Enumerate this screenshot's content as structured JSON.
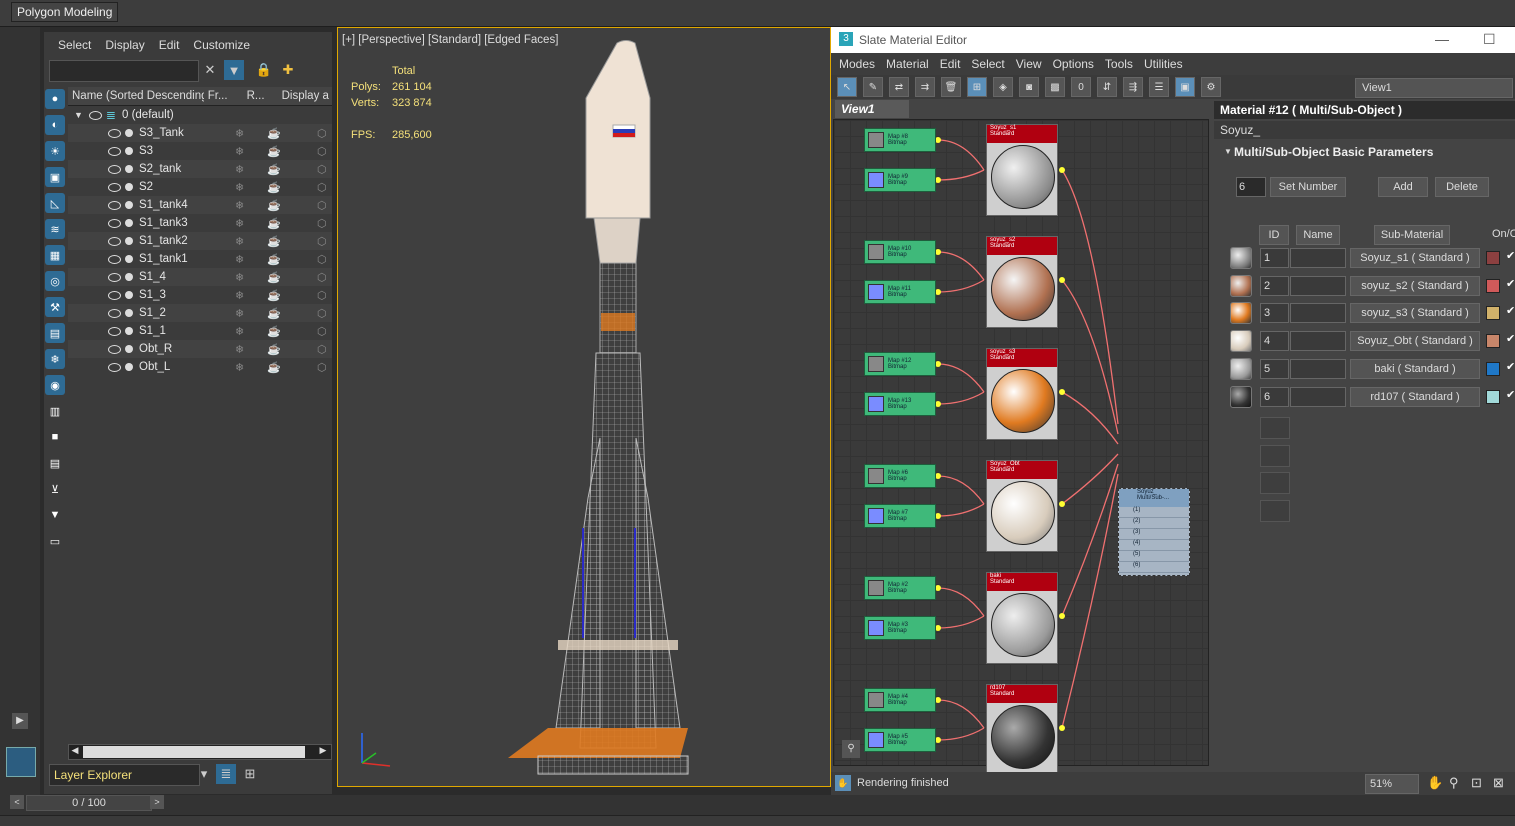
{
  "ribbon": {
    "tab": "Polygon Modeling"
  },
  "explorer": {
    "menu": [
      "Select",
      "Display",
      "Edit",
      "Customize"
    ],
    "columns": [
      "Name (Sorted Descending)",
      "Fr...",
      "R...",
      "Display a"
    ],
    "root": "0 (default)",
    "items": [
      "S3_Tank",
      "S3",
      "S2_tank",
      "S2",
      "S1_tank4",
      "S1_tank3",
      "S1_tank2",
      "S1_tank1",
      "S1_4",
      "S1_3",
      "S1_2",
      "S1_1",
      "Obt_R",
      "Obt_L"
    ],
    "layer_label": "Layer Explorer"
  },
  "viewport": {
    "label": "[+] [Perspective] [Standard] [Edged Faces]",
    "stats": {
      "total_label": "Total",
      "polys_label": "Polys:",
      "polys": "261 104",
      "verts_label": "Verts:",
      "verts": "323 874",
      "fps_label": "FPS:",
      "fps": "285,600"
    }
  },
  "slate": {
    "title": "Slate Material Editor",
    "menu": [
      "Modes",
      "Material",
      "Edit",
      "Select",
      "View",
      "Options",
      "Tools",
      "Utilities"
    ],
    "view_dropdown": "View1",
    "view_tab": "View1",
    "status": "Rendering finished",
    "zoom": "51%",
    "maps": [
      {
        "name": "Map #8",
        "type": "Bitmap"
      },
      {
        "name": "Map #9",
        "type": "Bitmap"
      },
      {
        "name": "Map #10",
        "type": "Bitmap"
      },
      {
        "name": "Map #11",
        "type": "Bitmap"
      },
      {
        "name": "Map #12",
        "type": "Bitmap"
      },
      {
        "name": "Map #13",
        "type": "Bitmap"
      },
      {
        "name": "Map #6",
        "type": "Bitmap"
      },
      {
        "name": "Map #7",
        "type": "Bitmap"
      },
      {
        "name": "Map #2",
        "type": "Bitmap"
      },
      {
        "name": "Map #3",
        "type": "Bitmap"
      },
      {
        "name": "Map #4",
        "type": "Bitmap"
      },
      {
        "name": "Map #5",
        "type": "Bitmap"
      }
    ],
    "materials": [
      {
        "name": "Soyuz_s1",
        "type": "Standard"
      },
      {
        "name": "soyuz_s2",
        "type": "Standard"
      },
      {
        "name": "soyuz_s3",
        "type": "Standard"
      },
      {
        "name": "Soyuz_Obt",
        "type": "Standard"
      },
      {
        "name": "baki",
        "type": "Standard"
      },
      {
        "name": "rd107",
        "type": "Standard"
      }
    ],
    "multi_node": {
      "name": "Soyuz_",
      "type": "Multi/Sub-...",
      "slots": [
        "(1)",
        "(2)",
        "(3)",
        "(4)",
        "(5)",
        "(6)"
      ]
    }
  },
  "props": {
    "title": "Material #12  ( Multi/Sub-Object )",
    "name_field": "Soyuz_",
    "rollout": "Multi/Sub-Object Basic Parameters",
    "count": "6",
    "set_number": "Set Number",
    "add": "Add",
    "delete": "Delete",
    "headers": {
      "id": "ID",
      "name": "Name",
      "sub": "Sub-Material",
      "onoff": "On/O"
    },
    "rows": [
      {
        "id": "1",
        "sub": "Soyuz_s1  ( Standard )",
        "color": "#8c4040"
      },
      {
        "id": "2",
        "sub": "soyuz_s2  ( Standard )",
        "color": "#d05a5a"
      },
      {
        "id": "3",
        "sub": "soyuz_s3  ( Standard )",
        "color": "#d2b26a"
      },
      {
        "id": "4",
        "sub": "Soyuz_Obt  ( Standard )",
        "color": "#c8866a"
      },
      {
        "id": "5",
        "sub": "baki  ( Standard )",
        "color": "#1f78c8"
      },
      {
        "id": "6",
        "sub": "rd107  ( Standard )",
        "color": "#a2dada"
      }
    ]
  },
  "timeline": {
    "frame": "0 / 100"
  }
}
